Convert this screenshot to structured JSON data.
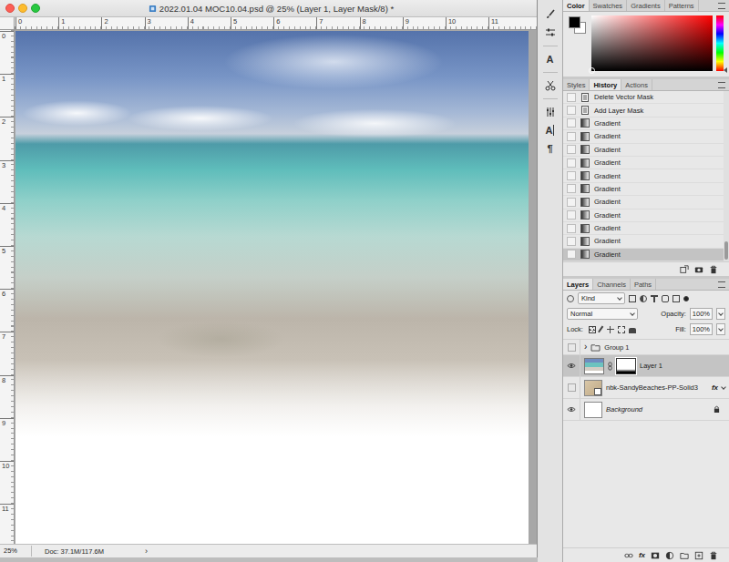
{
  "window": {
    "title": "2022.01.04 MOC10.04.psd @ 25% (Layer 1, Layer Mask/8) *"
  },
  "rulers": {
    "top": [
      "0",
      "1",
      "2",
      "3",
      "4",
      "5",
      "6",
      "7",
      "8",
      "9",
      "10",
      "11"
    ],
    "left": [
      "0",
      "1",
      "2",
      "3",
      "4",
      "5",
      "6",
      "7",
      "8",
      "9",
      "10",
      "11"
    ]
  },
  "status_bar": {
    "zoom": "25%",
    "doc": "Doc: 37.1M/117.6M",
    "arrow": "›"
  },
  "dock_glyphs": [
    "A",
    "A",
    "¶"
  ],
  "color_panel": {
    "tabs": [
      {
        "label": "Color",
        "selected": true
      },
      {
        "label": "Swatches",
        "selected": false
      },
      {
        "label": "Gradients",
        "selected": false
      },
      {
        "label": "Patterns",
        "selected": false
      }
    ],
    "foreground": "#000000",
    "background": "#ffffff"
  },
  "history_panel": {
    "tabs": [
      {
        "label": "Styles",
        "selected": false
      },
      {
        "label": "History",
        "selected": true
      },
      {
        "label": "Actions",
        "selected": false
      }
    ],
    "items": [
      {
        "label": "Delete Vector Mask",
        "kind": "document",
        "selected": false
      },
      {
        "label": "Add Layer Mask",
        "kind": "document",
        "selected": false
      },
      {
        "label": "Gradient",
        "kind": "gradient",
        "selected": false
      },
      {
        "label": "Gradient",
        "kind": "gradient",
        "selected": false
      },
      {
        "label": "Gradient",
        "kind": "gradient",
        "selected": false
      },
      {
        "label": "Gradient",
        "kind": "gradient",
        "selected": false
      },
      {
        "label": "Gradient",
        "kind": "gradient",
        "selected": false
      },
      {
        "label": "Gradient",
        "kind": "gradient",
        "selected": false
      },
      {
        "label": "Gradient",
        "kind": "gradient",
        "selected": false
      },
      {
        "label": "Gradient",
        "kind": "gradient",
        "selected": false
      },
      {
        "label": "Gradient",
        "kind": "gradient",
        "selected": false
      },
      {
        "label": "Gradient",
        "kind": "gradient",
        "selected": false
      },
      {
        "label": "Gradient",
        "kind": "gradient",
        "selected": true
      }
    ]
  },
  "layers_panel": {
    "tabs": [
      {
        "label": "Layers",
        "selected": true
      },
      {
        "label": "Channels",
        "selected": false
      },
      {
        "label": "Paths",
        "selected": false
      }
    ],
    "filter": "Kind",
    "blend_mode": "Normal",
    "opacity_label": "Opacity:",
    "opacity": "100%",
    "lock_label": "Lock:",
    "fill_label": "Fill:",
    "fill": "100%",
    "layers": [
      {
        "name": "Group 1",
        "kind": "group",
        "visible": false,
        "selected": false,
        "expanded": false,
        "chevron": "›"
      },
      {
        "name": "Layer 1",
        "kind": "pixel",
        "visible": true,
        "selected": true
      },
      {
        "name": "nbk-SandyBeaches-PP-Solid3",
        "kind": "smart",
        "visible": false,
        "selected": false,
        "effects": "fx"
      },
      {
        "name": "Background",
        "kind": "background",
        "visible": true,
        "selected": false,
        "locked": true
      }
    ],
    "footer_fx": "fx"
  }
}
